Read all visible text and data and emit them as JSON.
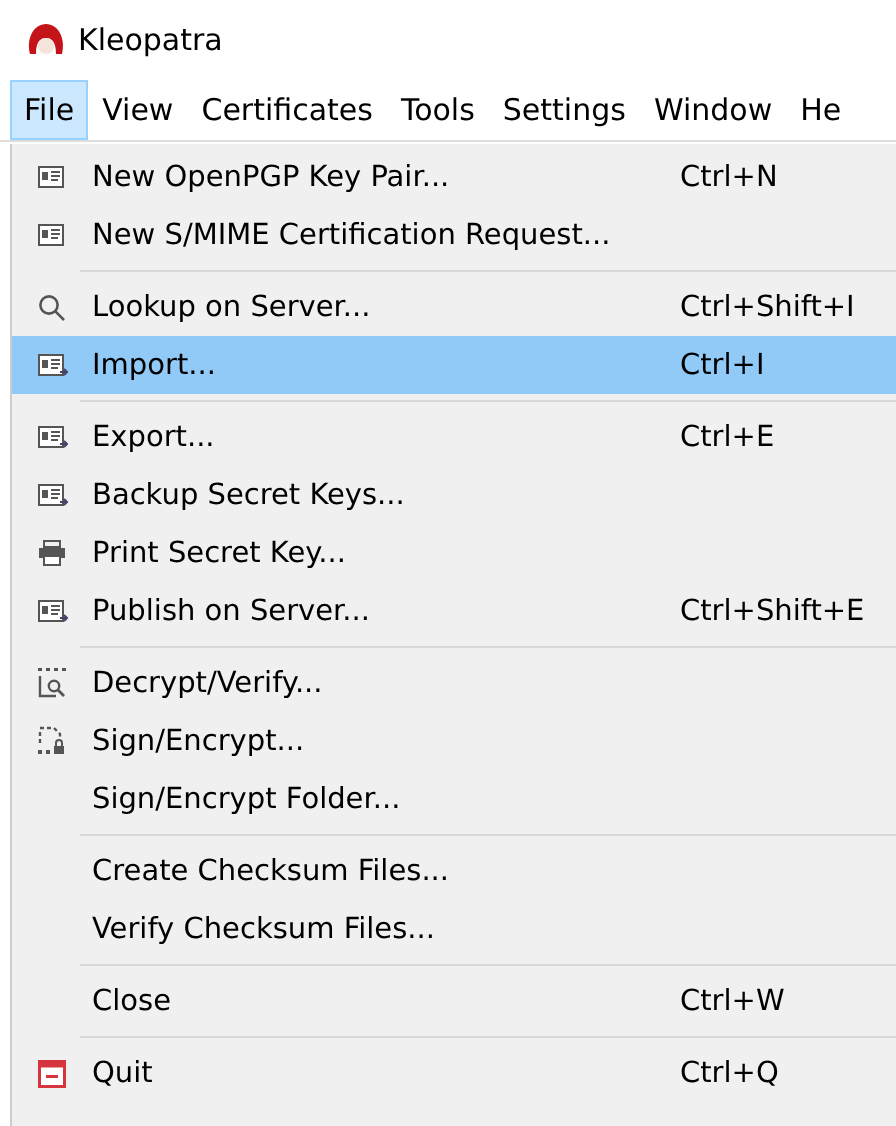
{
  "window": {
    "title": "Kleopatra"
  },
  "menubar": [
    {
      "label": "File",
      "selected": true
    },
    {
      "label": "View",
      "selected": false
    },
    {
      "label": "Certificates",
      "selected": false
    },
    {
      "label": "Tools",
      "selected": false
    },
    {
      "label": "Settings",
      "selected": false
    },
    {
      "label": "Window",
      "selected": false
    },
    {
      "label": "He",
      "selected": false
    }
  ],
  "menu_groups": [
    [
      {
        "label": "New OpenPGP Key Pair...",
        "shortcut": "Ctrl+N",
        "selected": false
      },
      {
        "label": "New S/MIME Certification Request...",
        "selected": false
      }
    ],
    [
      {
        "label": "Lookup on Server...",
        "shortcut": "Ctrl+Shift+I",
        "selected": false
      },
      {
        "label": "Import...",
        "shortcut": "Ctrl+I",
        "selected": true
      }
    ],
    [
      {
        "label": "Export...",
        "shortcut": "Ctrl+E",
        "selected": false
      },
      {
        "label": "Backup Secret Keys...",
        "selected": false
      },
      {
        "label": "Print Secret Key...",
        "selected": false
      },
      {
        "label": "Publish on Server...",
        "shortcut": "Ctrl+Shift+E",
        "selected": false
      }
    ],
    [
      {
        "label": "Decrypt/Verify...",
        "selected": false
      },
      {
        "label": "Sign/Encrypt...",
        "selected": false
      },
      {
        "label": "Sign/Encrypt Folder...",
        "selected": false
      }
    ],
    [
      {
        "label": "Create Checksum Files...",
        "selected": false
      },
      {
        "label": "Verify Checksum Files...",
        "selected": false
      }
    ],
    [
      {
        "label": "Close",
        "shortcut": "Ctrl+W",
        "selected": false
      }
    ],
    [
      {
        "label": "Quit",
        "shortcut": "Ctrl+Q",
        "selected": false
      }
    ]
  ]
}
